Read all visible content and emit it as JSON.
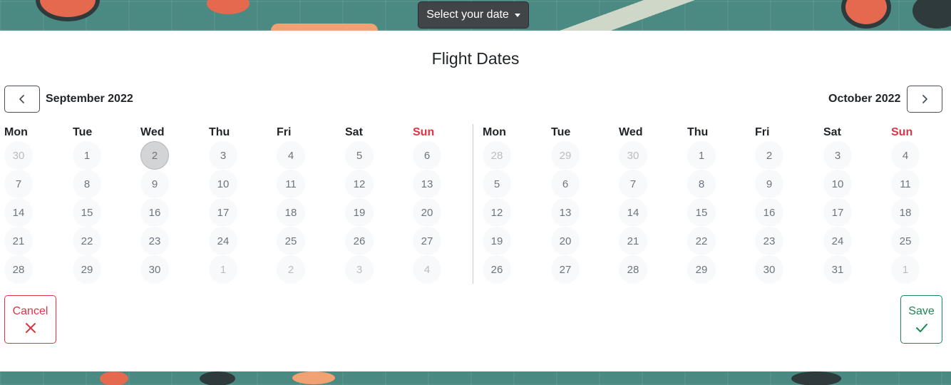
{
  "dropdown": {
    "label": "Select your date"
  },
  "title": "Flight Dates",
  "nav": {
    "prev_icon": "chevron-left-icon",
    "next_icon": "chevron-right-icon"
  },
  "left_calendar": {
    "month_label": "September 2022",
    "weekdays": [
      "Mon",
      "Tue",
      "Wed",
      "Thu",
      "Fri",
      "Sat",
      "Sun"
    ],
    "weeks": [
      [
        {
          "d": "30",
          "m": true
        },
        {
          "d": "1"
        },
        {
          "d": "2",
          "sel": true
        },
        {
          "d": "3"
        },
        {
          "d": "4"
        },
        {
          "d": "5"
        },
        {
          "d": "6"
        }
      ],
      [
        {
          "d": "7"
        },
        {
          "d": "8"
        },
        {
          "d": "9"
        },
        {
          "d": "10"
        },
        {
          "d": "11"
        },
        {
          "d": "12"
        },
        {
          "d": "13"
        }
      ],
      [
        {
          "d": "14"
        },
        {
          "d": "15"
        },
        {
          "d": "16"
        },
        {
          "d": "17"
        },
        {
          "d": "18"
        },
        {
          "d": "19"
        },
        {
          "d": "20"
        }
      ],
      [
        {
          "d": "21"
        },
        {
          "d": "22"
        },
        {
          "d": "23"
        },
        {
          "d": "24"
        },
        {
          "d": "25"
        },
        {
          "d": "26"
        },
        {
          "d": "27"
        }
      ],
      [
        {
          "d": "28"
        },
        {
          "d": "29"
        },
        {
          "d": "30"
        },
        {
          "d": "1",
          "m": true
        },
        {
          "d": "2",
          "m": true
        },
        {
          "d": "3",
          "m": true
        },
        {
          "d": "4",
          "m": true
        }
      ]
    ]
  },
  "right_calendar": {
    "month_label": "October 2022",
    "weekdays": [
      "Mon",
      "Tue",
      "Wed",
      "Thu",
      "Fri",
      "Sat",
      "Sun"
    ],
    "weeks": [
      [
        {
          "d": "28",
          "m": true
        },
        {
          "d": "29",
          "m": true
        },
        {
          "d": "30",
          "m": true
        },
        {
          "d": "1"
        },
        {
          "d": "2"
        },
        {
          "d": "3"
        },
        {
          "d": "4"
        }
      ],
      [
        {
          "d": "5"
        },
        {
          "d": "6"
        },
        {
          "d": "7"
        },
        {
          "d": "8"
        },
        {
          "d": "9"
        },
        {
          "d": "10"
        },
        {
          "d": "11"
        }
      ],
      [
        {
          "d": "12"
        },
        {
          "d": "13"
        },
        {
          "d": "14"
        },
        {
          "d": "15"
        },
        {
          "d": "16"
        },
        {
          "d": "17"
        },
        {
          "d": "18"
        }
      ],
      [
        {
          "d": "19"
        },
        {
          "d": "20"
        },
        {
          "d": "21"
        },
        {
          "d": "22"
        },
        {
          "d": "23"
        },
        {
          "d": "24"
        },
        {
          "d": "25"
        }
      ],
      [
        {
          "d": "26"
        },
        {
          "d": "27"
        },
        {
          "d": "28"
        },
        {
          "d": "29"
        },
        {
          "d": "30"
        },
        {
          "d": "31"
        },
        {
          "d": "1",
          "m": true
        }
      ]
    ]
  },
  "actions": {
    "cancel_label": "Cancel",
    "cancel_icon": "close-icon",
    "save_label": "Save",
    "save_icon": "check-icon"
  },
  "colors": {
    "cancel": "#dc3545",
    "save": "#198754",
    "sunday": "#dc3545",
    "dropdown_bg": "#424548"
  }
}
